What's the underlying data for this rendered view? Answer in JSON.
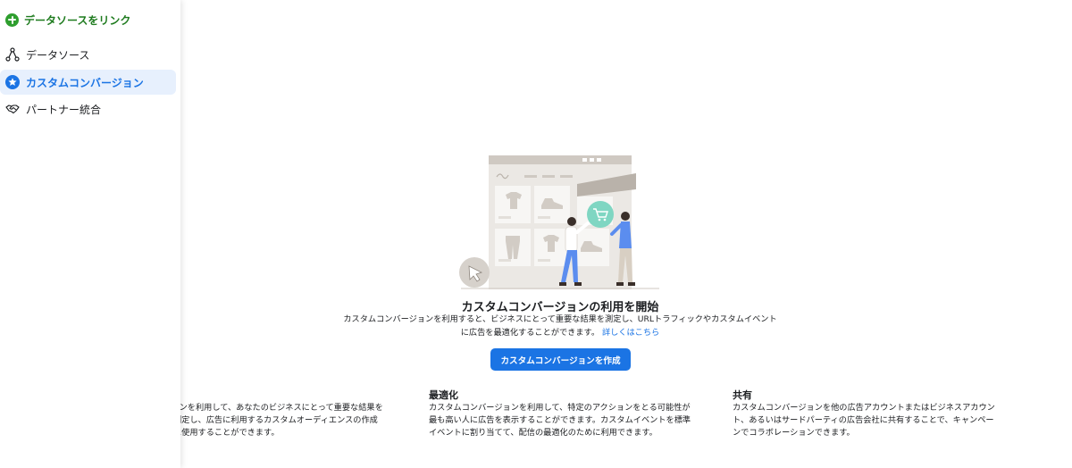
{
  "sidebar": {
    "link_data_source": {
      "label": "データソースをリンク",
      "icon": "plus-circle-icon",
      "color": "#2e9e2e"
    },
    "items": [
      {
        "label": "データソース",
        "icon": "data-source-nodes-icon",
        "active": false
      },
      {
        "label": "カスタムコンバージョン",
        "icon": "star-circle-icon",
        "active": true
      },
      {
        "label": "パートナー統合",
        "icon": "handshake-icon",
        "active": false
      }
    ]
  },
  "main": {
    "empty_state": {
      "title": "カスタムコンバージョンの利用を開始",
      "description": "カスタムコンバージョンを利用すると、ビジネスにとって重要な結果を測定し、URLトラフィックやカスタムイベントに広告を最適化することができます。",
      "learn_more": "詳しくはこちら",
      "button_label": "カスタムコンバージョンを作成"
    },
    "features": [
      {
        "title": "",
        "description": "パージョンを利用して、あなたのビジネスにとって重要な結果を測定し、広告に利用するカスタムオーディエンスの作成に使用することができます。"
      },
      {
        "title": "最適化",
        "description": "カスタムコンバージョンを利用して、特定のアクションをとる可能性が最も高い人に広告を表示することができます。カスタムイベントを標準イベントに割り当てて、配信の最適化のために利用できます。"
      },
      {
        "title": "共有",
        "description": "カスタムコンバージョンを他の広告アカウントまたはビジネスアカウント、あるいはサードパーティの広告会社に共有することで、キャンペーンでコラボレーションできます。"
      }
    ]
  },
  "colors": {
    "accent": "#1b74e4",
    "active_bg": "#e7f0fd",
    "green": "#2e9e2e"
  }
}
